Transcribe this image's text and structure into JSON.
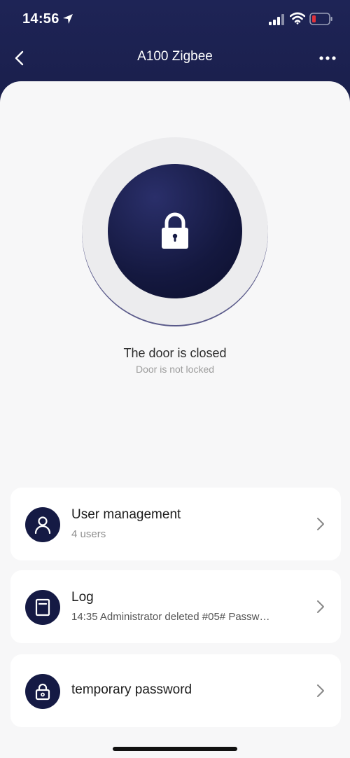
{
  "status_bar": {
    "time": "14:56"
  },
  "nav": {
    "title": "A100 Zigbee"
  },
  "lock": {
    "door_status": "The door is closed",
    "lock_status": "Door is not locked"
  },
  "cards": [
    {
      "title": "User management",
      "subtitle": "4 users",
      "icon": "user-icon"
    },
    {
      "title": "Log",
      "subtitle": "14:35 Administrator deleted #05# Passw…",
      "icon": "log-icon"
    },
    {
      "title": "temporary password",
      "icon": "lock-small-icon"
    }
  ],
  "colors": {
    "header_bg": "#1e2456",
    "accent_dark": "#151a44",
    "battery_low": "#e0323c"
  }
}
